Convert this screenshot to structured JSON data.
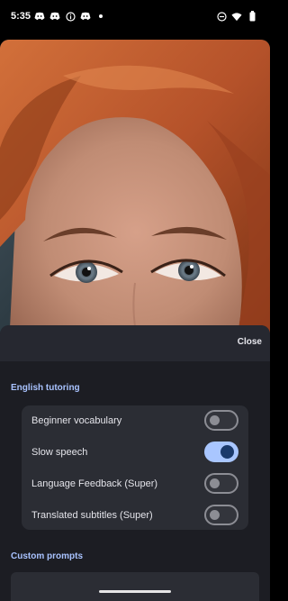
{
  "status_bar": {
    "time": "5:35",
    "notification_icons": [
      "discord-icon",
      "discord-icon",
      "info-icon",
      "discord-icon",
      "dot-icon"
    ],
    "system_icons": [
      "do-not-disturb-icon",
      "wifi-icon",
      "battery-icon"
    ]
  },
  "sheet": {
    "close_label": "Close",
    "sections": [
      {
        "title": "English tutoring",
        "settings": [
          {
            "label": "Beginner vocabulary",
            "enabled": false
          },
          {
            "label": "Slow speech",
            "enabled": true
          },
          {
            "label": "Language Feedback (Super)",
            "enabled": false
          },
          {
            "label": "Translated subtitles (Super)",
            "enabled": false
          }
        ]
      },
      {
        "title": "Custom prompts"
      }
    ]
  },
  "colors": {
    "accent": "#a9c3ff",
    "toggle_on_track": "#a9c6ff",
    "toggle_on_knob": "#1b3a6b",
    "sheet_background": "#1c1d23",
    "card_background": "#2b2d34"
  }
}
